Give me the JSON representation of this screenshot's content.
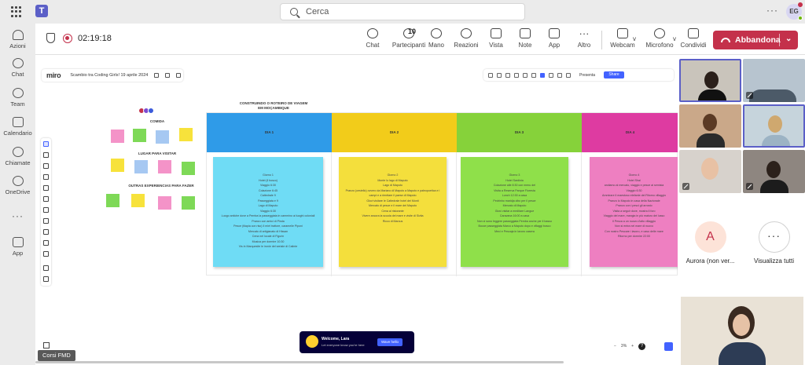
{
  "topbar": {
    "search_placeholder": "Cerca",
    "more_dots": "···",
    "user_initials": "EG"
  },
  "rail": {
    "items": [
      {
        "label": "Azioni",
        "icon": "bell-icon"
      },
      {
        "label": "Chat",
        "icon": "chat-icon"
      },
      {
        "label": "Team",
        "icon": "teams-icon"
      },
      {
        "label": "Calendario",
        "icon": "calendar-icon"
      },
      {
        "label": "Chiamate",
        "icon": "phone-icon"
      },
      {
        "label": "OneDrive",
        "icon": "cloud-icon"
      },
      {
        "label": "App",
        "icon": "add-app-icon"
      }
    ],
    "more": "···"
  },
  "meeting": {
    "timer": "02:19:18",
    "participants_count": "10",
    "buttons": [
      {
        "label": "Chat",
        "icon": "chat-icon"
      },
      {
        "label": "Partecipanti",
        "icon": "people-icon"
      },
      {
        "label": "Mano",
        "icon": "hand-icon"
      },
      {
        "label": "Reazioni",
        "icon": "emoji-icon"
      },
      {
        "label": "Vista",
        "icon": "grid-view-icon"
      },
      {
        "label": "Note",
        "icon": "notes-icon"
      },
      {
        "label": "App",
        "icon": "add-icon"
      },
      {
        "label": "Altro",
        "icon": "more-icon"
      },
      {
        "label": "Webcam",
        "icon": "camera-icon"
      },
      {
        "label": "Microfono",
        "icon": "mic-icon"
      },
      {
        "label": "Condividi",
        "icon": "share-icon"
      }
    ],
    "leave_label": "Abbandona",
    "colors": {
      "leave": "#c4314b",
      "accent": "#5b5fc7"
    }
  },
  "miro": {
    "logo": "miro",
    "board_name": "Scambio tra Coding Girls! 19 aprile 2024",
    "present_label": "Presenta",
    "share_label": "Share",
    "board_title_lines": [
      "CONSTRUINDO O ROTEIRO DE VIAGEM",
      "EM MOÇAMBIQUE"
    ],
    "section_labels": [
      "COMIDA",
      "LUGAR PARA VISITAR",
      "OUTRAS EXPERIENCIAS PARA FAZER"
    ],
    "columns": [
      {
        "head": "DIA 1",
        "head_color": "#2f9be8",
        "note_color": "#6fdcf5",
        "lines": [
          "Giorno 1",
          "Hotel (il bosco)",
          "Viaggio 6:30",
          "Colazione 6:45",
          "Cattedrale 9",
          "Passeggiata e 9",
          "Lago di Maputo",
          "Viaggio 6:30",
          "Luogo antiche dove a Pemba la passeggiata in cammino ai luoghi coloniali",
          "Pranzo con amici di Pinda",
          "Pesce (tilapia con riso) Il miel trattore, caramelle Piponi",
          "Mercato di artigianato di Hissan",
          "Cena nel locale di Figurin",
          "Musica per dormire 10:30",
          "Vis in Marquesite le ironie del seriale di Calinte"
        ]
      },
      {
        "head": "DIA 2",
        "head_color": "#f2cc1a",
        "note_color": "#f4df3c",
        "lines": [
          "Giorno 2",
          "Monte lo lago di Maputo",
          "Lago di Maputo",
          "Pranzo (cestello) ovvero da Mariano di Maputo a Maputo e paleopoetica e i campi e a rienttare il paese di Maputo",
          "Giovi visitare le Cattedrale hotel dei Monti",
          "Mercato di pesce e il mare del Maputo",
          "Cena al ristorante",
          "Vivere ancora la scuola del mare e visite di Sivita",
          "Ricco di Marcus"
        ]
      },
      {
        "head": "DIA 3",
        "head_color": "#86d23a",
        "note_color": "#8fe04a",
        "lines": [
          "Giorno 3",
          "Hotel Sardinia",
          "Colazione alle 8:30 con menu del",
          "Visita a Reserva Parque Floresta",
          "Lunch 12:30 a casa",
          "Pedrinho maridja cibo per il pesce",
          "Mercato di Maputo",
          "Giovi visitar a meditare Langue",
          "Caravana 16:00 a casa",
          "Non ci sono leggere passeggiata Pemba anche per il basso",
          "Bocce passeggiata Marco a Maputo dopo e villaggi bosco",
          "Meci e Pescaja in lavoro casera"
        ]
      },
      {
        "head": "DIA 4",
        "head_color": "#de3ba1",
        "note_color": "#ee7fc1",
        "lines": [
          "Giorno 4",
          "Hotel Shai",
          "andiamo al mercato, viaggio e pesce ai semisia",
          "Viaggio 6:30",
          "Ammirare il maestoso elefante del Ritorno villaggio",
          "Pranzo lo Maputo in casa della Nazionale",
          "Pranzo con i pesci gli arrosto",
          "Visita a seguir dove, mostra il foro",
          "Viaggio del mare, mangia in più maturo del lusso",
          "Il Pesca a un nuovo d'alto villaggio",
          "Non si entra nel mare di nuovo",
          "Con nostro Pescare i lavoro, e caso delle mare",
          "Ritorno per dormire 22:00"
        ]
      }
    ],
    "welcome": {
      "title": "Welcome, Lara",
      "subtitle": "Let everyone know you're here",
      "button": "Wave hello"
    },
    "zoom": {
      "minus": "−",
      "level": "3%",
      "plus": "+",
      "help": "?"
    },
    "presenter_name": "Corsi FMD",
    "colors": {
      "brand": "#4262ff"
    }
  },
  "gallery": {
    "participant_a_initial": "A",
    "participant_a_name": "Aurora (non ver...",
    "view_all_label": "Visualizza tutti",
    "more_glyph": "···"
  }
}
